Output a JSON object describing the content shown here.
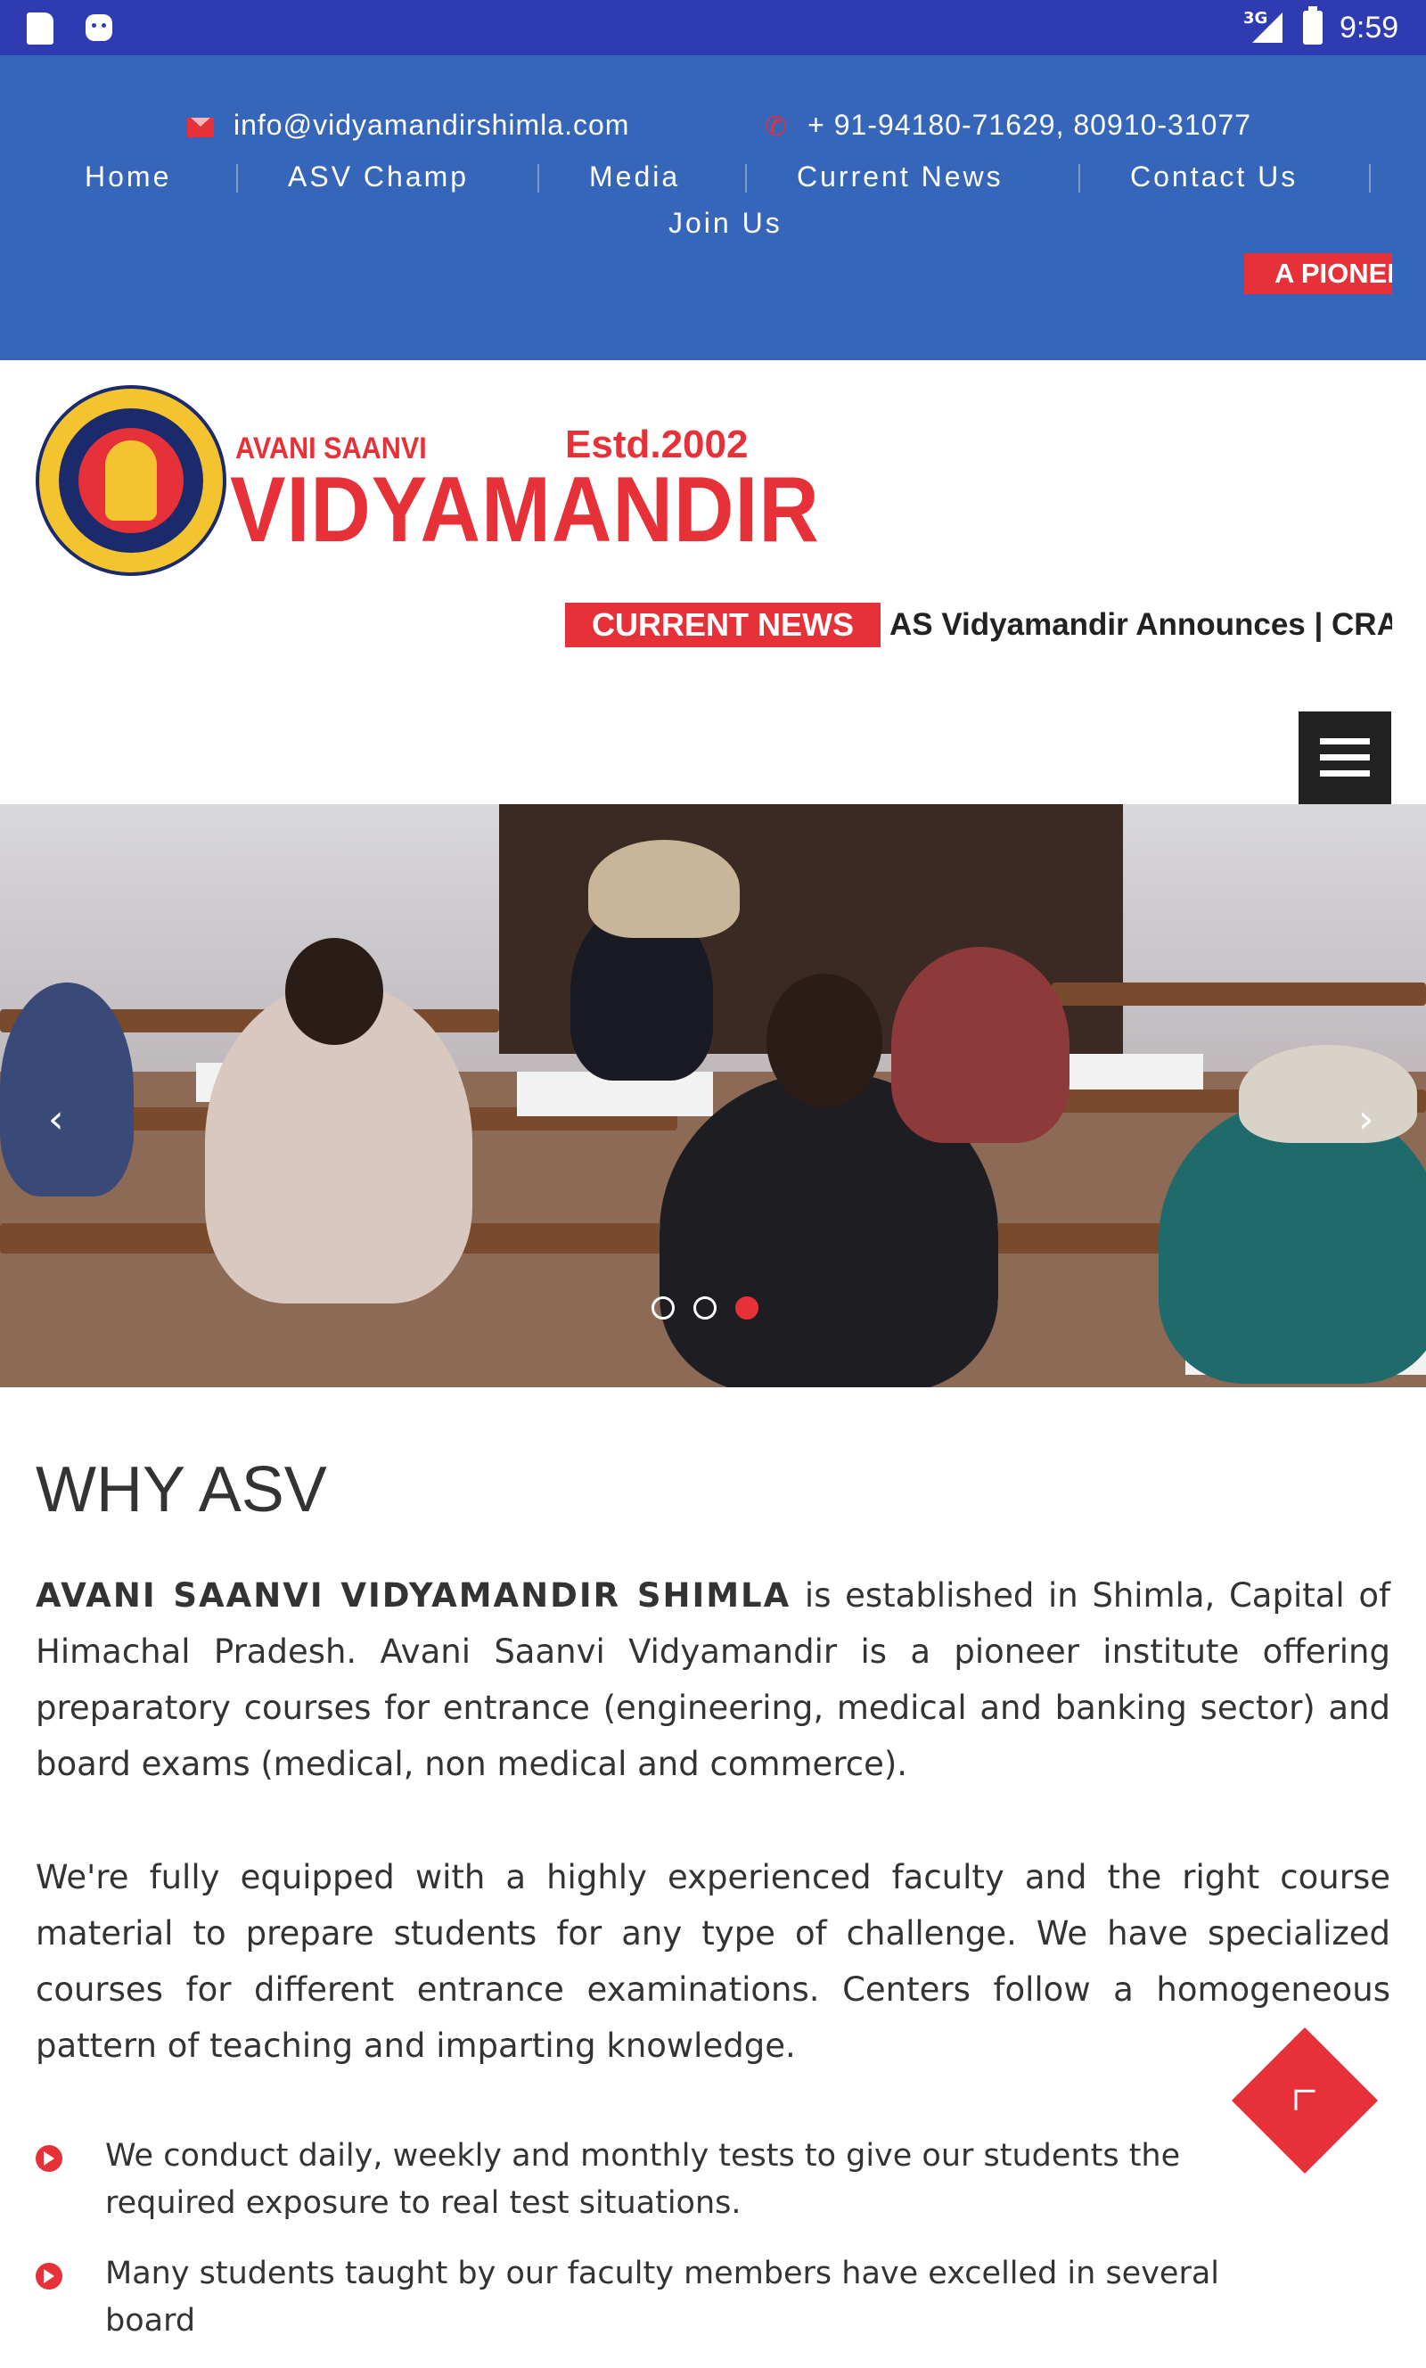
{
  "status_bar": {
    "network": "3G",
    "time": "9:59"
  },
  "header": {
    "email": "info@vidyamandirshimla.com",
    "phone": "+ 91-94180-71629, 80910-31077",
    "nav": [
      "Home",
      "ASV Champ",
      "Media",
      "Current News",
      "Contact Us",
      "Join Us"
    ],
    "tagline_ticker": "A PIONEER"
  },
  "logo": {
    "small": "AVANI SAANVI",
    "estd": "Estd.2002",
    "big": "VIDYAMANDIR"
  },
  "news": {
    "label": "CURRENT NEWS",
    "ticker": "AS Vidyamandir Announces | CRASH COURSE"
  },
  "slider": {
    "slide_count": 3,
    "active_slide": 3
  },
  "why": {
    "title": "WHY ASV",
    "para1_bold": "AVANI SAANVI VIDYAMANDIR SHIMLA",
    "para1_rest": " is established in Shimla, Capital of Himachal Pradesh. Avani Saanvi Vidyamandir is a pioneer institute offering preparatory courses for entrance (engineering, medical and banking sector) and board exams (medical, non medical and commerce).",
    "para2": "We're fully equipped with a highly experienced faculty and the right course material to prepare students for any type of challenge. We have specialized courses for different entrance examinations. Centers follow a homogeneous pattern of teaching and imparting knowledge.",
    "bullets": [
      "We conduct daily, weekly and monthly tests to give our students the required exposure to real test situations.",
      "Many students taught by our faculty members have excelled in several board"
    ]
  },
  "colors": {
    "status_bar": "#2f3bb0",
    "header": "#3666b9",
    "accent": "#e53137",
    "text": "#333333"
  }
}
